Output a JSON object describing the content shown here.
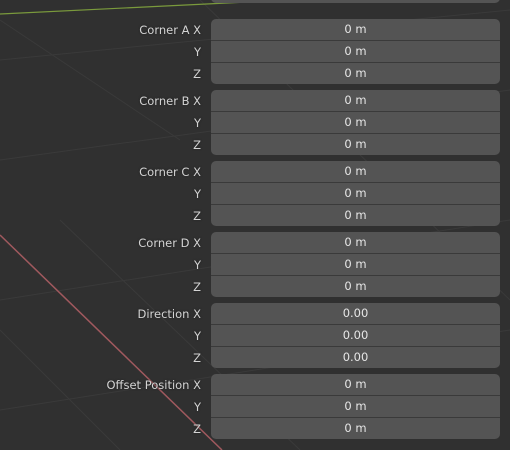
{
  "groups": [
    {
      "name": "Corner A",
      "labels": [
        "Corner A X",
        "Y",
        "Z"
      ],
      "values": [
        "0 m",
        "0 m",
        "0 m"
      ]
    },
    {
      "name": "Corner B",
      "labels": [
        "Corner B X",
        "Y",
        "Z"
      ],
      "values": [
        "0 m",
        "0 m",
        "0 m"
      ]
    },
    {
      "name": "Corner C",
      "labels": [
        "Corner C X",
        "Y",
        "Z"
      ],
      "values": [
        "0 m",
        "0 m",
        "0 m"
      ]
    },
    {
      "name": "Corner D",
      "labels": [
        "Corner D X",
        "Y",
        "Z"
      ],
      "values": [
        "0 m",
        "0 m",
        "0 m"
      ]
    },
    {
      "name": "Direction",
      "labels": [
        "Direction X",
        "Y",
        "Z"
      ],
      "values": [
        "0.00",
        "0.00",
        "0.00"
      ]
    },
    {
      "name": "Offset Position",
      "labels": [
        "Offset Position X",
        "Y",
        "Z"
      ],
      "values": [
        "0 m",
        "0 m",
        "0 m"
      ]
    }
  ],
  "colors": {
    "x_axis": "#a0595e",
    "y_axis": "#7a9a3c",
    "field": "#545454",
    "background": "#303030"
  }
}
